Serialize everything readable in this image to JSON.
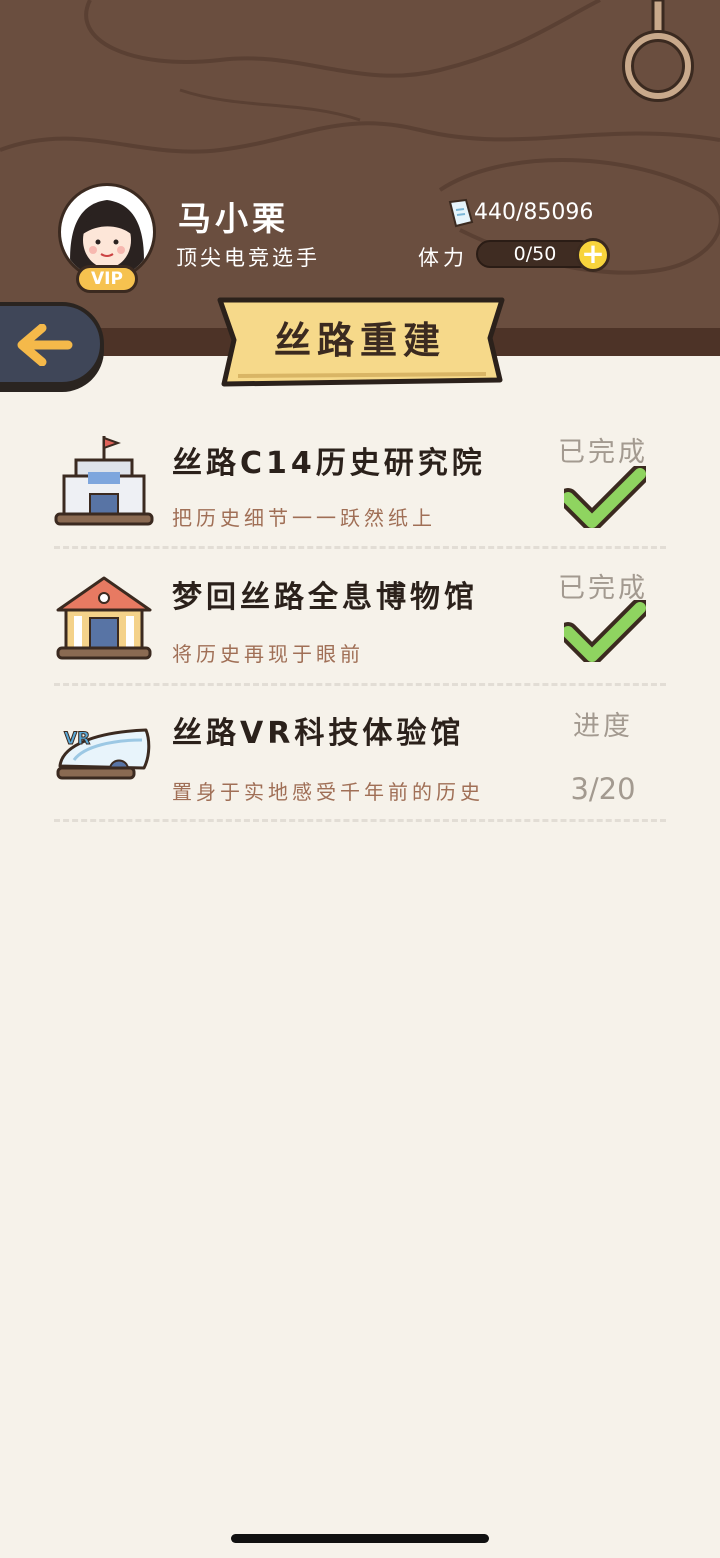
{
  "colors": {
    "header_bg": "#6a4e3f",
    "page_bg": "#f6f2ea",
    "banner_bg": "#f6d98a",
    "check_green": "#8fd460",
    "vip_gold": "#f6c24f"
  },
  "profile": {
    "name": "马小栗",
    "title": "顶尖电竞选手",
    "vip_label": "VIP",
    "avatar_icon": "avatar-girl-icon"
  },
  "stats": {
    "coins": "440/85096",
    "coin_icon": "receipt-icon",
    "stamina_label": "体力",
    "stamina_value": "0/50",
    "stamina_fraction": 0,
    "add_icon": "plus-icon"
  },
  "nav": {
    "back_icon": "arrow-left-icon",
    "banner_title": "丝路重建"
  },
  "items": [
    {
      "name": "丝路C14历史研究院",
      "desc": "把历史细节一一跃然纸上",
      "status": "已完成",
      "icon": "research-institute-icon",
      "completed": true
    },
    {
      "name": "梦回丝路全息博物馆",
      "desc": "将历史再现于眼前",
      "status": "已完成",
      "icon": "museum-icon",
      "completed": true
    },
    {
      "name": "丝路VR科技体验馆",
      "desc": "置身于实地感受千年前的历史",
      "status": "进度",
      "progress": "3/20",
      "icon": "vr-hall-icon",
      "vr_label": "VR",
      "completed": false
    }
  ]
}
